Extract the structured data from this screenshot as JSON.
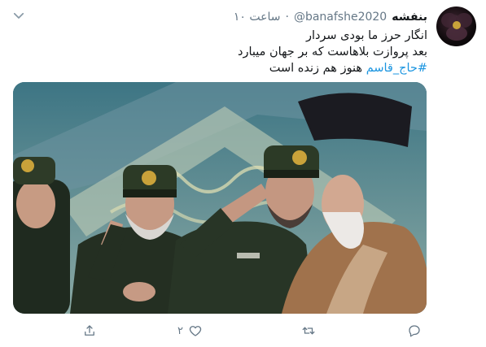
{
  "tweet": {
    "author_name": "بنفشه",
    "author_handle": "@banafshe2020",
    "separator": "·",
    "timestamp": "۱۰ ساعت",
    "lines": [
      "انگار حرز ما بودی سردار",
      "بعد پروازت بلاهاست که بر جهان میبارد"
    ],
    "hashtag": "#حاج_قاسم",
    "last_line_rest": "هنوز هم زنده است",
    "like_count": "۲"
  },
  "icons": {
    "menu": "chevron-down-icon",
    "reply": "reply-icon",
    "retweet": "retweet-icon",
    "like": "heart-icon",
    "share": "share-icon"
  },
  "colors": {
    "link": "#1b95e0",
    "secondary_text": "#657786",
    "primary_text": "#14171a"
  }
}
